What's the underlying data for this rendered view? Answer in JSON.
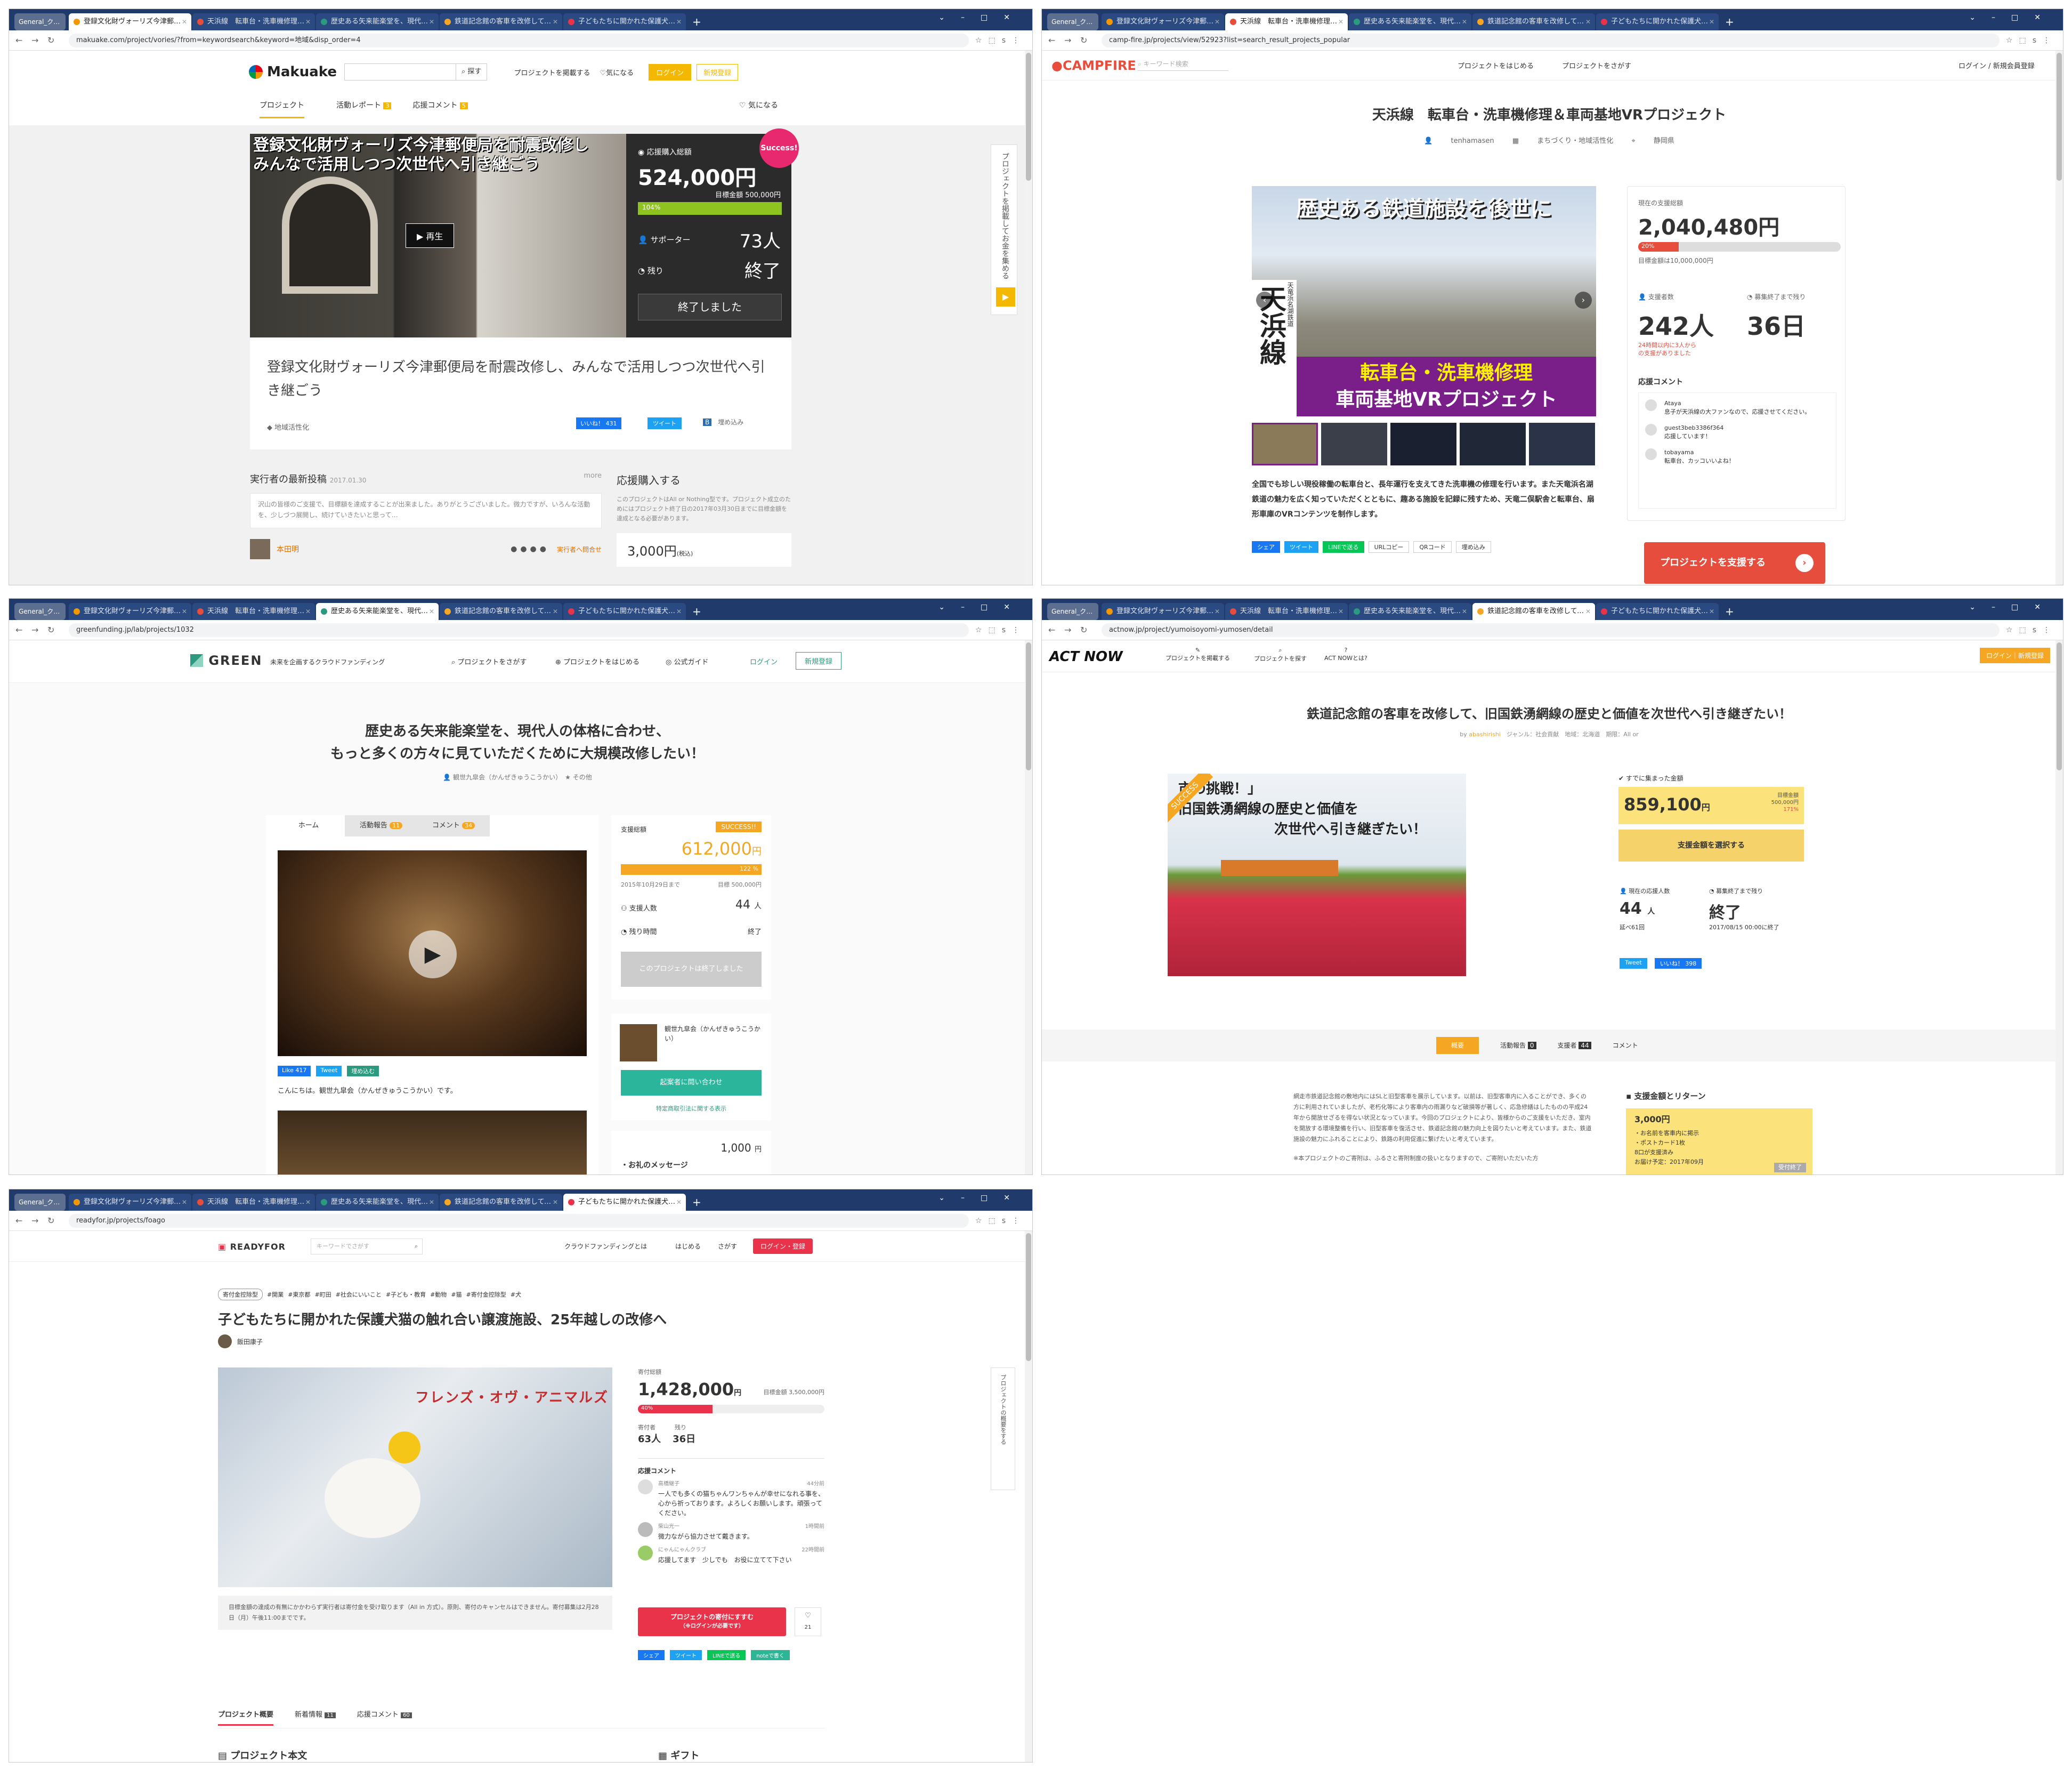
{
  "browser": {
    "group_label": "General_クラファン",
    "tabs": [
      "登録文化財ヴォーリズ今津郵便局を耐",
      "天浜線　転車台・洗車機修理＆車両基",
      "歴史ある矢来能楽堂を、現代人の体格に",
      "鉄道記念館の客車を改修して、旧国鉄",
      "子どもたちに開かれた保護犬猫の触れ"
    ],
    "new_tab": "+"
  },
  "makuake": {
    "url": "makuake.com/project/vories/?from=keywordsearch&keyword=地域&disp_order=4",
    "logo": "Makuake",
    "search_btn": "探す",
    "nav": [
      "プロジェクトを掲載する",
      "気になる"
    ],
    "login": "ログイン",
    "signup": "新規登録",
    "subnav": [
      "プロジェクト",
      "活動レポート",
      "応援コメント"
    ],
    "subnav_counts": [
      "3",
      "5"
    ],
    "favorite": "気になる",
    "hero_caption": "登録文化財ヴォーリズ今津郵便局を耐震改修し\nみんなで活用しつつ次世代へ引き継ごう",
    "play": "▶ 再生",
    "success": "Success!",
    "total_label": "応援購入総額",
    "total": "524,000円",
    "goal": "目標金額 500,000円",
    "percent": "104%",
    "percent_value": 104,
    "supporters_label": "サポーター",
    "supporters": "73人",
    "remaining_label": "残り",
    "remaining": "終了",
    "ended": "終了しました",
    "title": "登録文化財ヴォーリズ今津郵便局を耐震改修し、みんなで活用しつつ次世代へ引き継ごう",
    "tag": "地域活性化",
    "like": "いいね！ 431",
    "tweet": "ツイート",
    "embed": "埋め込み",
    "side_tab": "プロジェクトを掲載してお金を集める",
    "latest_label": "実行者の最新投稿",
    "latest_date": "2017.01.30",
    "more": "more",
    "latest_text": "沢山の皆様のご支援で、目標額を達成することが出来ました。ありがとうございました。微力ですが、いろんな活動を、少しづつ展開し、続けていきたいと思って…",
    "author": "本田明",
    "contact": "実行者へ問合せ",
    "buy_label": "応援購入する",
    "buy_text": "このプロジェクトはAll or Nothing型です。プロジェクト成立のためにはプロジェクト終了日の2017年03月30日までに目標金額を達成となる必要があります。",
    "price": "3,000円",
    "price_tax": "(税込)"
  },
  "campfire": {
    "url": "camp-fire.jp/projects/view/52923?list=search_result_projects_popular",
    "logo": "CAMPFIRE",
    "search_ph": "キーワード検索",
    "nav": [
      "プロジェクトをはじめる",
      "プロジェクトをさがす"
    ],
    "login": "ログイン",
    "slash": "/",
    "signup": "新規会員登録",
    "title": "天浜線　転車台・洗車機修理＆車両基地VRプロジェクト",
    "meta": [
      "tenhamasen",
      "まちづくり・地域活性化",
      "静岡県"
    ],
    "hero_top": "歴史ある鉄道施設を後世に",
    "hero_left": "天浜線",
    "hero_left_small": "天竜浜名湖鉄道",
    "hero_bottom1": "転車台・洗車機修理",
    "hero_bottom2": "車両基地VRプロジェクト",
    "raised_label": "現在の支援総額",
    "raised": "2,040,480円",
    "percent": "20%",
    "percent_value": 20,
    "goal": "目標金額は10,000,000円",
    "backers_label": "支援者数",
    "backers": "242人",
    "days_label": "募集終了まで残り",
    "days": "36日",
    "recent": "24時間以内に3人から\nの支援がありました",
    "comments_label": "応援コメント",
    "comments": [
      {
        "name": "Ataya",
        "text": "息子が天浜線の大ファンなので、応援させてください。"
      },
      {
        "name": "guest3beb3386f364",
        "text": "応援しています！"
      },
      {
        "name": "tobayama",
        "text": "転車台、カッコいいよね！"
      }
    ],
    "desc": "全国でも珍しい現役稼働の転車台と、長年運行を支えてきた洗車機の修理を行います。また天竜浜名湖鉄道の魅力を広く知っていただくとともに、趣ある施設を記録に残すため、天竜二俣駅舎と転車台、扇形車庫のVRコンテンツを制作します。",
    "share": [
      "シェア",
      "ツイート",
      "LINEで送る",
      "URLコピー",
      "QRコード",
      "埋め込み"
    ],
    "cta": "プロジェクトを支援する"
  },
  "green": {
    "url": "greenfunding.jp/lab/projects/1032",
    "logo": "GREEN",
    "tagline": "未来を企画するクラウドファンディング",
    "nav": [
      "プロジェクトをさがす",
      "プロジェクトをはじめる",
      "公式ガイド"
    ],
    "login": "ログイン",
    "signup": "新規登録",
    "title1": "歴史ある矢来能楽堂を、現代人の体格に合わせ、",
    "title2": "もっと多くの方々に見ていただくために大規模改修したい！",
    "owner": "観世九皐会（かんぜきゅうこうかい）",
    "category": "その他",
    "tabs": [
      "ホーム",
      "活動報告",
      "コメント"
    ],
    "tab_counts": [
      "11",
      "34"
    ],
    "total_label": "支援総額",
    "success": "SUCCESS!!",
    "total": "612,000",
    "yen": "円",
    "percent": "122 %",
    "percent_value": 122,
    "deadline": "2015年10月29日まで",
    "goal": "目標 500,000円",
    "backers_label": "支援人数",
    "backers": "44",
    "backers_unit": "人",
    "remaining_label": "残り時間",
    "remaining": "終了",
    "ended_btn": "このプロジェクトは終了しました",
    "like": "Like 417",
    "tweet": "Tweet",
    "embed": "埋め込む",
    "intro": "こんにちは。観世九皐会（かんぜきゅうこうかい）です。",
    "owner_card": "観世九皐会（かんぜきゅうこうかい）",
    "contact": "起案者に問い合わせ",
    "law": "特定商取引法に関する表示",
    "reward_price": "1,000",
    "reward_title": "・お礼のメッセージ"
  },
  "actnow": {
    "url": "actnow.jp/project/yumoisoyomi-yumosen/detail",
    "logo": "ACT NOW",
    "nav": [
      "プロジェクトを掲載する",
      "プロジェクトを探す",
      "ACT NOWとは?"
    ],
    "login": "ログイン｜新規登録",
    "title": "鉄道記念館の客車を改修して、旧国鉄湧網線の歴史と価値を次世代へ引き継ぎたい！",
    "by": "by",
    "author": "abashirishi",
    "meta": [
      "ジャンル：社会貢献",
      "地域：北海道",
      "期限：All or"
    ],
    "hero_text1": "市の挑戦！」",
    "hero_text2": "旧国鉄湧網線の歴史と価値を",
    "hero_text3": "次世代へ引き継ぎたい！",
    "success": "SUCCESS",
    "raised_label": "すでに集まった金額",
    "raised": "859,100",
    "yen": "円",
    "goal_label": "目標金額",
    "goal": "500,000円",
    "percent": "171%",
    "select": "支援金額を選択する",
    "backers_label": "現在の応援人数",
    "backers": "44",
    "backers_unit": "人",
    "backers_sub": "延べ61回",
    "end_label": "募集終了まで残り",
    "end": "終了",
    "end_date": "2017/08/15 00:00に終了",
    "tweet": "Tweet",
    "like": "いいね！ 398",
    "tabs": [
      "概要",
      "活動報告",
      "支援者",
      "コメント"
    ],
    "tab_counts": [
      "0",
      "44"
    ],
    "body": "網走市鉄道記念館の敷地内にはSLと旧型客車を展示しています。以前は、旧型客車内に入ることができ、多くの方に利用されていましたが、老朽化等により客車内の雨漏りなど破損等が著しく、応急修繕はしたものの平成24年から開放せざるを得ない状況となっています。今回のプロジェクトにより、皆様からのご支援をいただき、室内を開放する環境整備を行い、旧型客車を復活させ、鉄道記念館の魅力向上を図りたいと考えています。また、鉄道施設の魅力にふれることにより、鉄路の利用促進に繋げたいと考えています。",
    "body2": "※本プロジェクトのご寄附は、ふるさと寄附制度の扱いとなりますので、ご寄附いただいた方",
    "reward_header": "支援金額とリターン",
    "reward_price": "3,000円",
    "reward_items": [
      "・お名前を客車内に掲示",
      "・ポストカード1枚"
    ],
    "reward_count": "8口が支援済み",
    "reward_date": "お届け予定：2017年09月",
    "reward_badge": "受付終了"
  },
  "readyfor": {
    "url": "readyfor.jp/projects/foago",
    "logo": "READYFOR",
    "search_ph": "キーワードでさがす",
    "nav": [
      "クラウドファンディングとは",
      "はじめる",
      "さがす"
    ],
    "login": "ログイン・登録",
    "tags": [
      "寄付金控除型",
      "#開業",
      "#東京都",
      "#町田",
      "#社会にいいこと",
      "#子ども・教育",
      "#動物",
      "#猫",
      "#寄付金控除型",
      "#犬"
    ],
    "title": "子どもたちに開かれた保護犬猫の触れ合い譲渡施設、25年越しの改修へ",
    "owner": "飯田康子",
    "hero_text": "フレンズ・オヴ・アニマルズ",
    "raised_label": "寄付総額",
    "raised": "1,428,000",
    "yen": "円",
    "goal": "目標金額 3,500,000円",
    "percent": "40%",
    "percent_value": 40,
    "donors_label": "寄付者",
    "donors": "63人",
    "days_label": "残り",
    "days": "36日",
    "comments_label": "応援コメント",
    "comments": [
      {
        "name": "高橋継子",
        "time": "44分前",
        "text": "一人でも多くの猫ちゃんワンちゃんが幸せになれる事を、心から祈っております。よろしくお願いします。頑張ってください。"
      },
      {
        "name": "柴山光一",
        "time": "1時間前",
        "text": "微力ながら協力させて戴きます。"
      },
      {
        "name": "にゃんにゃんクラブ",
        "time": "22時間前",
        "text": "応援してます　少しでも　お役に立てて下さい"
      }
    ],
    "notice": "目標金額の達成の有無にかかわらず実行者は寄付金を受け取ります（All in 方式）。原則、寄付のキャンセルはできません。寄付募集は2月28日（月）午後11:00までです。",
    "cta1": "プロジェクトの寄付にすすむ",
    "cta2": "（※ログインが必要です）",
    "fav_count": "21",
    "share": [
      "シェア",
      "ツイート",
      "LINEで送る",
      "noteで書く"
    ],
    "tabs": [
      "プロジェクト概要",
      "新着情報",
      "応援コメント"
    ],
    "tab_counts": [
      "11",
      "60"
    ],
    "bottom_left": "プロジェクト本文",
    "bottom_right": "ギフト",
    "side_tab": "プロジェクトの概要をする"
  }
}
